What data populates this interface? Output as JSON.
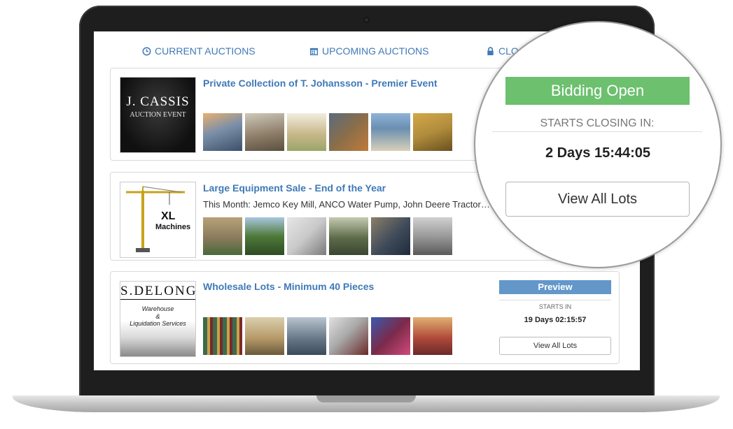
{
  "nav": {
    "current": "CURRENT AUCTIONS",
    "upcoming": "UPCOMING AUCTIONS",
    "closed": "CLO"
  },
  "auctions": [
    {
      "title": "Private Collection of T. Johansson - Premier Event",
      "logo_line1": "J. CASSIS",
      "logo_line2": "AUCTION EVENT",
      "thumbs": [
        "#7a8fa8",
        "#8f7f6a",
        "#c8b88a",
        "#8a6e4a",
        "#6a8fb0",
        "#b08c3c"
      ]
    },
    {
      "title": "Large Equipment Sale - End of the Year",
      "description": "This Month: Jemco Key Mill, ANCO Water Pump, John Deere Tractor…",
      "logo_line1": "XL",
      "logo_line2": "Machines",
      "thumbs": [
        "#8a7a5c",
        "#4e7a3a",
        "#c9c9c9",
        "#5d6b4a",
        "#3f4a5a",
        "#9a9a9a"
      ]
    },
    {
      "title": "Wholesale Lots - Minimum 40 Pieces",
      "logo_line1": "S.DELONG",
      "logo_line2": "Warehouse",
      "logo_line3": "&",
      "logo_line4": "Liquidation Services",
      "status": "Preview",
      "starts_label": "STARTS IN",
      "starts_time": "19 Days 02:15:57",
      "view_all": "View All Lots",
      "thumbs": [
        "#3d6a4e",
        "#b89a6a",
        "#6a7a8a",
        "#a9a9a9",
        "#7a2a4a",
        "#b04a3a"
      ]
    }
  ],
  "magnifier": {
    "status": "Bidding Open",
    "label": "STARTS CLOSING IN:",
    "time": "2 Days 15:44:05",
    "view_all": "View All Lots"
  },
  "colors": {
    "link": "#3f79b8",
    "bidding_open": "#6cc06e",
    "preview": "#6397c9"
  }
}
